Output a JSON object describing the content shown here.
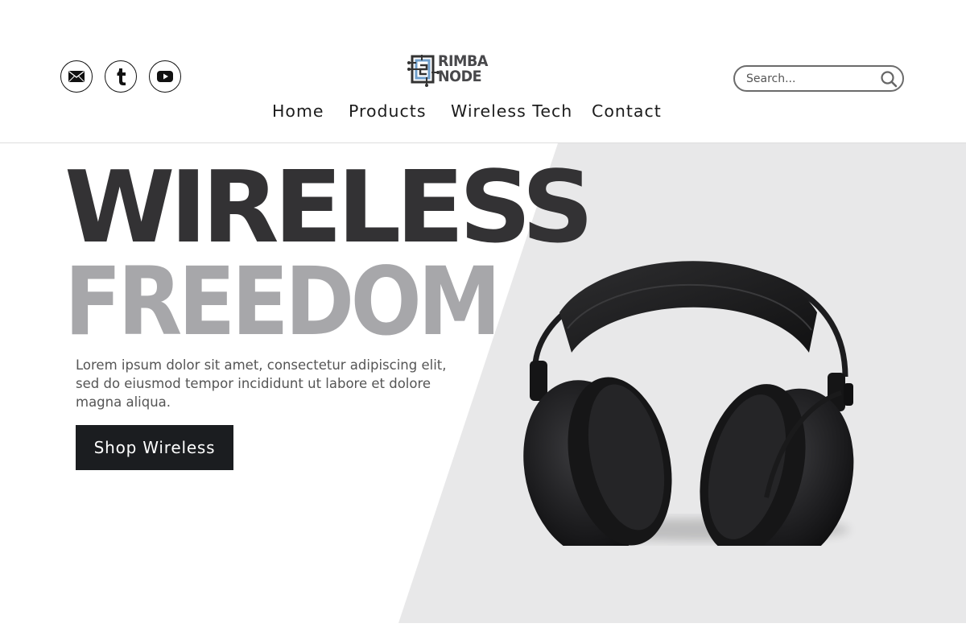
{
  "social": [
    {
      "name": "email",
      "icon": "email-icon"
    },
    {
      "name": "tumblr",
      "icon": "tumblr-icon"
    },
    {
      "name": "youtube",
      "icon": "youtube-icon"
    }
  ],
  "logo": {
    "line1": "RIMBA",
    "line2": "NODE",
    "icon": "circuit-logo-icon"
  },
  "nav": {
    "items": [
      "Home",
      "Products",
      "Wireless Tech",
      "Contact"
    ]
  },
  "search": {
    "placeholder": "Search...",
    "value": "",
    "icon": "search-icon"
  },
  "hero": {
    "headline1": "WIRELESS",
    "headline2": "FREEDOM",
    "description": "Lorem ipsum dolor sit amet, consectetur adipiscing elit, sed do eiusmod tempor incididunt ut labore et dolore magna aliqua.",
    "cta_label": "Shop Wireless",
    "image": "headphones-image"
  },
  "colors": {
    "headline_dark": "#333234",
    "headline_light": "#a7a7aa",
    "panel_gray": "#e8e8e9",
    "button_dark": "#1b1d20",
    "logo_blue": "#6f9fcb"
  }
}
